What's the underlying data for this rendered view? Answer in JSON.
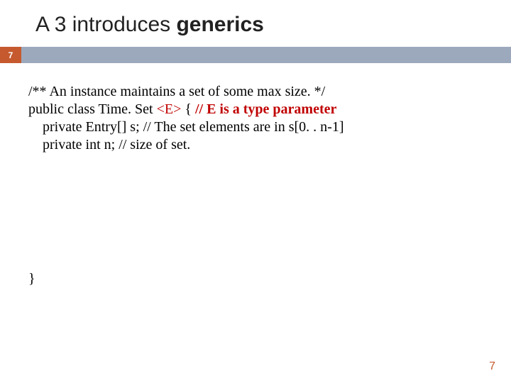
{
  "title": {
    "prefix": "A 3 introduces ",
    "bold": "generics"
  },
  "bar": {
    "number": "7"
  },
  "code": {
    "line1": "/** An instance maintains a set of some max size. */",
    "line2_a": "public class Time. Set ",
    "line2_generic": "<E> ",
    "line2_brace": "{   ",
    "line2_comment": "// E is a type parameter",
    "line3": "private Entry[] s; // The set elements are in s[0. . n-1]",
    "line4": "private int n;        // size of set.",
    "close": "}"
  },
  "footer": {
    "page": "7"
  }
}
